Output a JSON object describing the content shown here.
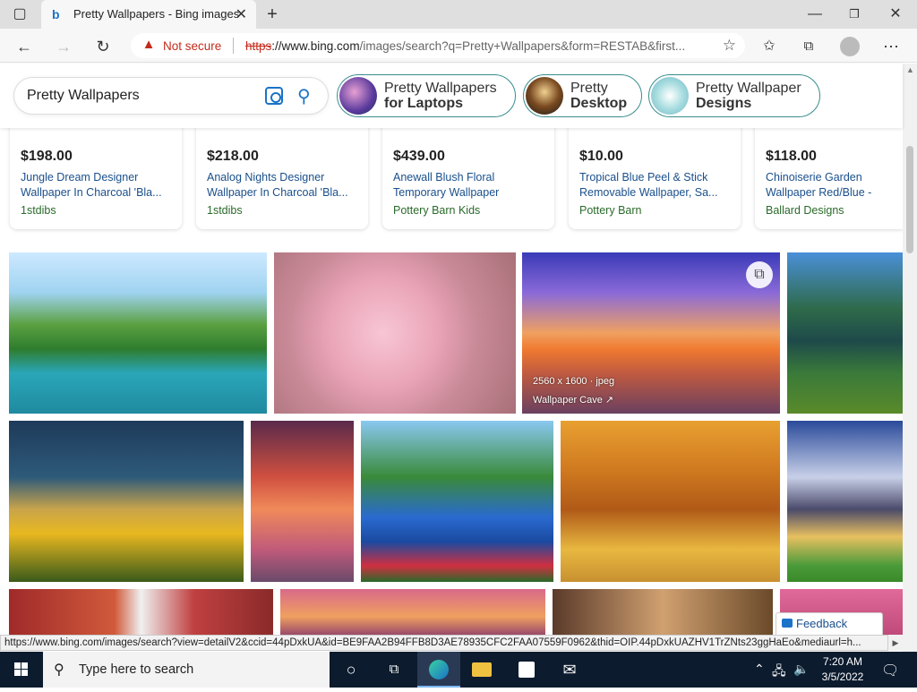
{
  "browser": {
    "tab_title": "Pretty Wallpapers - Bing images",
    "security_label": "Not secure",
    "url_proto": "https",
    "url_host": "://www.bing.com",
    "url_path": "/images/search?q=Pretty+Wallpapers&form=RESTAB&first..."
  },
  "search": {
    "query": "Pretty Wallpapers",
    "chips": [
      {
        "line1": "Pretty Wallpapers",
        "line2": "for Laptops"
      },
      {
        "line1": "Pretty",
        "line2": "Desktop"
      },
      {
        "line1": "Pretty Wallpaper",
        "line2": "Designs"
      }
    ]
  },
  "products": [
    {
      "price": "$198.00",
      "name": "Jungle Dream Designer Wallpaper In Charcoal 'Bla...",
      "store": "1stdibs"
    },
    {
      "price": "$218.00",
      "name": "Analog Nights Designer Wallpaper In Charcoal 'Bla...",
      "store": "1stdibs"
    },
    {
      "price": "$439.00",
      "name": "Anewall Blush Floral Temporary Wallpaper",
      "store": "Pottery Barn Kids"
    },
    {
      "price": "$10.00",
      "name": "Tropical Blue Peel & Stick Removable Wallpaper, Sa...",
      "store": "Pottery Barn"
    },
    {
      "price": "$118.00",
      "name": "Chinoiserie Garden Wallpaper Red/Blue - Balla...",
      "store": "Ballard Designs"
    }
  ],
  "hover_image": {
    "dims": "2560 x 1600 · jpeg",
    "source": "Wallpaper Cave ↗"
  },
  "feedback_label": "Feedback",
  "status_url": "https://www.bing.com/images/search?view=detailV2&ccid=44pDxkUA&id=BE9FAA2B94FFB8D3AE78935CFC2FAA07559F0962&thid=OIP.44pDxkUAZHV1TrZNts23ggHaEo&mediaurl=h...",
  "taskbar": {
    "search_placeholder": "Type here to search",
    "time": "7:20 AM",
    "date": "3/5/2022"
  }
}
